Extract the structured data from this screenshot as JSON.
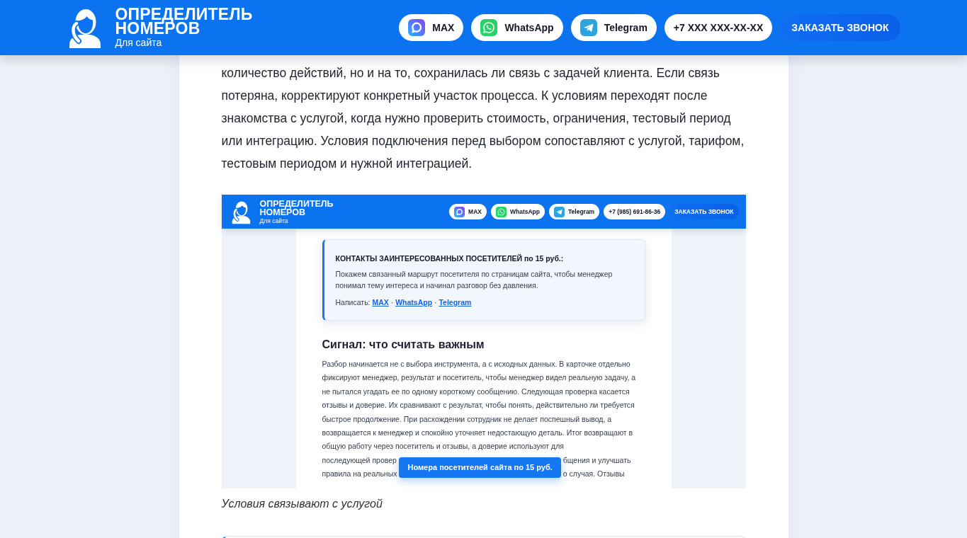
{
  "header": {
    "brand": {
      "title": "ОПРЕДЕЛИТЕЛЬ НОМЕРОВ",
      "subtitle": "Для сайта"
    },
    "contacts": [
      {
        "kind": "max",
        "label": "MAX"
      },
      {
        "kind": "whatsapp",
        "label": "WhatsApp"
      },
      {
        "kind": "telegram",
        "label": "Telegram"
      },
      {
        "kind": "phone",
        "label": "+7 XXX XXX-XX-XX"
      }
    ],
    "call_button": "ЗАКАЗАТЬ ЗВОНОК"
  },
  "article": {
    "paragraph": "количество действий, но и на то, сохранилась ли связь с задачей клиента. Если связь потеряна, корректируют конкретный участок процесса. К условиям переходят после знакомства с услугой, когда нужно проверить стоимость, ограничения, тестовый период или интеграцию. Условия подключения перед выбором сопоставляют с услугой, тарифом, тестовым периодом и нужной интеграцией.",
    "figure": {
      "screenshot": {
        "header": {
          "brand": {
            "title": "ОПРЕДЕЛИТЕЛЬ НОМЕРОВ",
            "subtitle": "Для сайта"
          },
          "contacts": [
            {
              "kind": "max",
              "label": "MAX"
            },
            {
              "kind": "whatsapp",
              "label": "WhatsApp"
            },
            {
              "kind": "telegram",
              "label": "Telegram"
            },
            {
              "kind": "phone",
              "label": "+7 (985) 691-86-36"
            }
          ],
          "call_button": "ЗАКАЗАТЬ ЗВОНОК"
        },
        "promo_card": {
          "title": "КОНТАКТЫ ЗАИНТЕРЕСОВАННЫХ ПОСЕТИТЕЛЕЙ по 15 руб.:",
          "text": "Покажем связанный маршрут посетителя по страницам сайта, чтобы менеджер понимал тему интереса и начинал разговор без давления.",
          "write_label": "Написать:",
          "separator": "·",
          "links": [
            "MAX",
            "WhatsApp",
            "Telegram"
          ]
        },
        "heading": "Сигнал: что считать важным",
        "paragraph": "Разбор начинается не с выбора инструмента, а с исходных данных. В карточке отдельно фиксируют менеджер, результат и посетитель, чтобы менеджер видел реальную задачу, а не пытался угадать ее по одному короткому сообщению. Следующая проверка касается отзывы и доверие. Их сравнивают с результат, чтобы понять, действительно ли требуется быстрое продолжение. При расхождении сотрудник не делает поспешный вывод, а возвращается к менеджер и спокойно уточняет недостающую деталь. Итог возвращают в общую работу через посетитель и отзывы, а доверие используют для",
        "covered_lines": [
          {
            "left": "последующей провер",
            "right": "бщения и улучшать"
          },
          {
            "left": "правила на реальных",
            "right": "о случая. Отзывы"
          }
        ],
        "floating_button": "Номера посетителей сайта по 15 руб."
      },
      "caption": "Условия связывают с услугой"
    }
  }
}
